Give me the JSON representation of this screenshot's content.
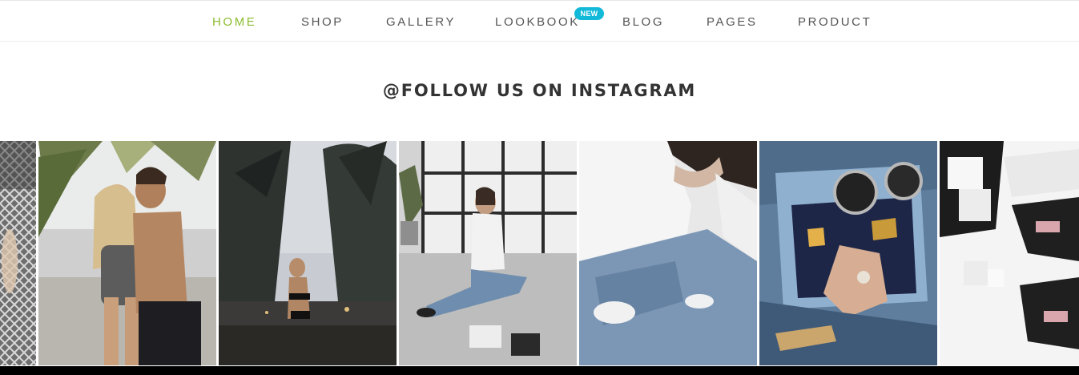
{
  "nav": {
    "items": [
      {
        "label": "HOME",
        "active": true
      },
      {
        "label": "SHOP"
      },
      {
        "label": "GALLERY"
      },
      {
        "label": "LOOKBOOK",
        "badge": "NEW"
      },
      {
        "label": "BLOG"
      },
      {
        "label": "PAGES"
      },
      {
        "label": "PRODUCT"
      }
    ]
  },
  "instagram": {
    "title": "@FOLLOW US ON INSTAGRAM",
    "tiles": [
      "partial-patterned-fabric",
      "beach-couple",
      "palm-tree-beach-swimsuit",
      "woman-sitting-on-floor",
      "white-shirt-ripped-jeans",
      "coach-bag-sunglasses",
      "sneakers-flat-lay"
    ]
  },
  "colors": {
    "active": "#8cbc2e",
    "badge": "#13b9d8",
    "text": "#555555",
    "title": "#333333"
  }
}
